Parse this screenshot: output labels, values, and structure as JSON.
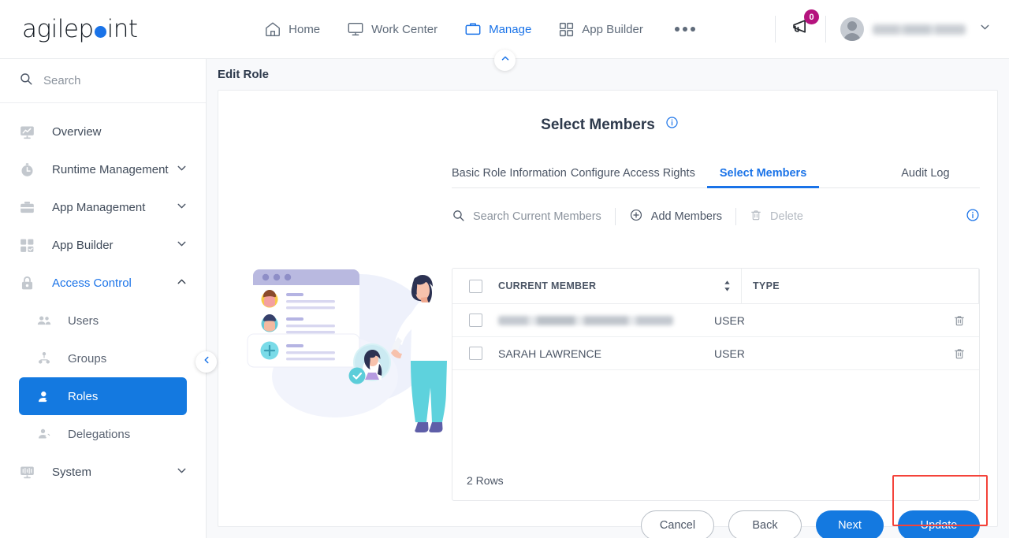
{
  "brand": {
    "name_part1": "agilep",
    "name_part2": "int",
    "dot": "o-dot",
    "accent": "#1a73e8"
  },
  "topnav": {
    "items": [
      {
        "label": "Home",
        "icon": "home-icon",
        "active": false
      },
      {
        "label": "Work Center",
        "icon": "monitor-icon",
        "active": false
      },
      {
        "label": "Manage",
        "icon": "briefcase-icon",
        "active": true
      },
      {
        "label": "App Builder",
        "icon": "grid-icon",
        "active": false
      }
    ],
    "overflow_icon": "ellipsis-icon",
    "notifications": {
      "icon": "megaphone-icon",
      "count": "0",
      "badge_color": "#b5137e"
    },
    "account": {
      "name": "",
      "avatar_icon": "user-avatar-icon",
      "chevron": "chevron-down-icon"
    }
  },
  "sidebar": {
    "search_placeholder": "Search",
    "search_icon": "search-icon",
    "collapse_icon": "chevron-left-icon",
    "items": [
      {
        "label": "Overview",
        "icon": "chart-monitor-icon",
        "expandable": false,
        "state": "default"
      },
      {
        "label": "Runtime Management",
        "icon": "stopwatch-icon",
        "expandable": true,
        "chevron": "chevron-down-icon",
        "state": "default"
      },
      {
        "label": "App Management",
        "icon": "briefcase-icon",
        "expandable": true,
        "chevron": "chevron-down-icon",
        "state": "default"
      },
      {
        "label": "App Builder",
        "icon": "grid-check-icon",
        "expandable": true,
        "chevron": "chevron-down-icon",
        "state": "default"
      },
      {
        "label": "Access Control",
        "icon": "lock-icon",
        "expandable": true,
        "chevron": "chevron-up-icon",
        "state": "accent"
      },
      {
        "label": "Users",
        "icon": "users-icon",
        "sub": true,
        "state": "default"
      },
      {
        "label": "Groups",
        "icon": "group-icon",
        "sub": true,
        "state": "default"
      },
      {
        "label": "Roles",
        "icon": "role-user-icon",
        "sub": true,
        "state": "selected"
      },
      {
        "label": "Delegations",
        "icon": "delegation-user-icon",
        "sub": true,
        "state": "default"
      },
      {
        "label": "System",
        "icon": "system-monitor-icon",
        "expandable": true,
        "chevron": "chevron-down-icon",
        "state": "default"
      }
    ]
  },
  "content": {
    "header_title": "Edit Role",
    "collapse_icon": "chevron-up-icon",
    "panel_title": "Select Members",
    "panel_info_icon": "info-icon",
    "tabs": [
      {
        "label": "Basic Role Information",
        "active": false
      },
      {
        "label": "Configure Access Rights",
        "active": false
      },
      {
        "label": "Select Members",
        "active": true
      },
      {
        "label": "Audit Log",
        "active": false
      }
    ],
    "toolbar": {
      "search_placeholder": "Search Current Members",
      "search_icon": "search-icon",
      "add_label": "Add Members",
      "add_icon": "plus-circle-icon",
      "delete_label": "Delete",
      "delete_icon": "trash-icon",
      "delete_disabled": true,
      "info_icon": "info-icon"
    },
    "table": {
      "select_all_icon": "checkbox-icon",
      "columns": [
        {
          "label": "CURRENT MEMBER",
          "sortable": true,
          "sort_icon": "sort-icon"
        },
        {
          "label": "TYPE",
          "sortable": false
        }
      ],
      "rows": [
        {
          "member": "",
          "member_redacted": true,
          "type": "USER",
          "delete_icon": "trash-icon",
          "checkbox": "checkbox-icon"
        },
        {
          "member": "SARAH LAWRENCE",
          "member_redacted": false,
          "type": "USER",
          "delete_icon": "trash-icon",
          "checkbox": "checkbox-icon"
        }
      ],
      "footer": "2 Rows"
    },
    "buttons": [
      {
        "label": "Cancel",
        "style": "outline"
      },
      {
        "label": "Back",
        "style": "outline"
      },
      {
        "label": "Next",
        "style": "primary"
      },
      {
        "label": "Update",
        "style": "primary",
        "highlighted": true
      }
    ],
    "highlight_color": "#f4433a"
  },
  "illustration": {
    "name": "select-members-illustration"
  }
}
